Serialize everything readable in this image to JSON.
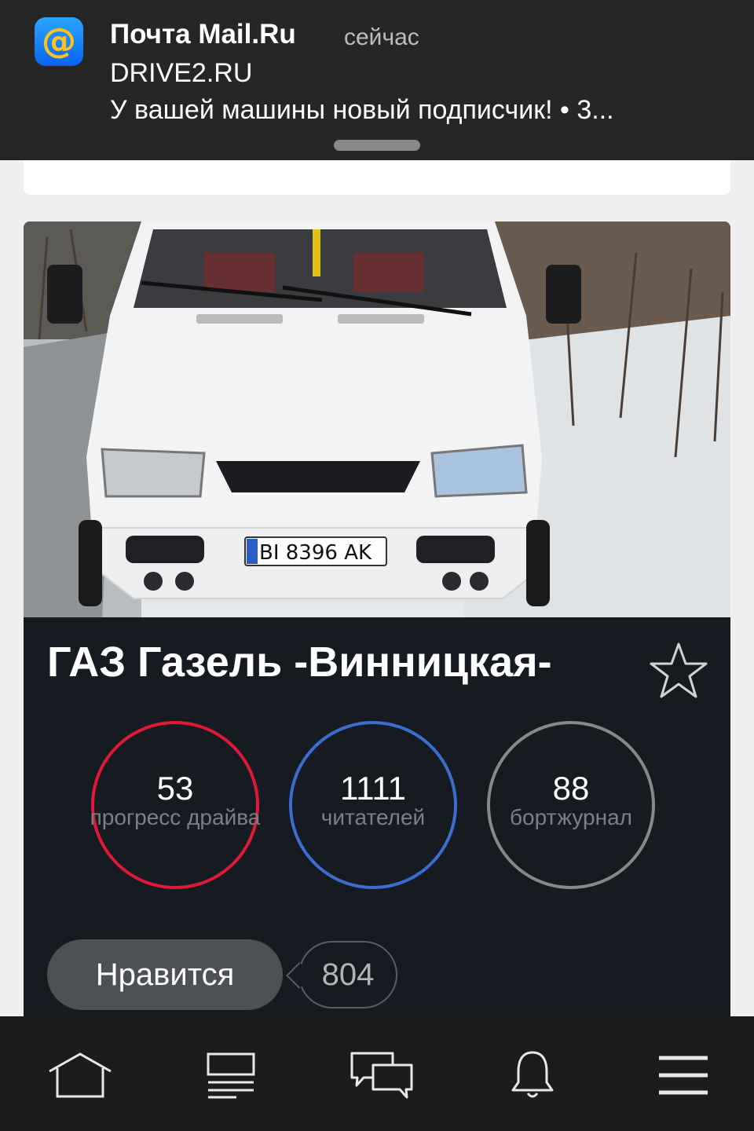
{
  "notification": {
    "app_name": "Почта Mail.Ru",
    "time": "сейчас",
    "sender": "DRIVE2.RU",
    "message": "У вашей машины новый подписчик! • 3...",
    "app_icon": "at-sign-icon"
  },
  "car_card": {
    "title": "ГАЗ Газель -Винницкая-",
    "photo_plate": "BI 8396 AK",
    "stats": [
      {
        "value": "53",
        "label": "прогресс драйва",
        "color": "#e0183a"
      },
      {
        "value": "1111",
        "label": "читателей",
        "color": "#3a6fd0"
      },
      {
        "value": "88",
        "label": "бортжурнал",
        "color": "#888888"
      }
    ],
    "like_label": "Нравится",
    "like_count": "804"
  },
  "tabbar": {
    "items": [
      {
        "icon": "home-icon"
      },
      {
        "icon": "feed-icon"
      },
      {
        "icon": "messages-icon"
      },
      {
        "icon": "bell-icon"
      },
      {
        "icon": "menu-icon"
      }
    ]
  }
}
